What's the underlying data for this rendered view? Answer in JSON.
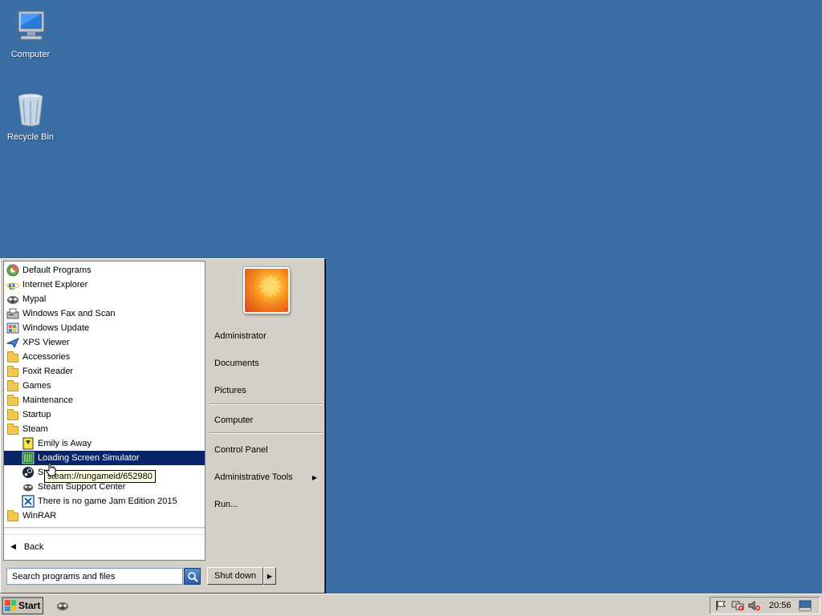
{
  "desktop": {
    "icons": [
      {
        "label": "Computer"
      },
      {
        "label": "Recycle Bin"
      }
    ],
    "background_color": "#3b6ea5"
  },
  "start_menu": {
    "programs": [
      {
        "label": "Default Programs",
        "icon": "default-programs-icon"
      },
      {
        "label": "Internet Explorer",
        "icon": "internet-explorer-icon"
      },
      {
        "label": "Mypal",
        "icon": "mypal-icon"
      },
      {
        "label": "Windows Fax and Scan",
        "icon": "fax-scan-icon"
      },
      {
        "label": "Windows Update",
        "icon": "windows-update-icon"
      },
      {
        "label": "XPS Viewer",
        "icon": "xps-viewer-icon"
      },
      {
        "label": "Accessories",
        "icon": "folder-icon"
      },
      {
        "label": "Foxit Reader",
        "icon": "folder-icon"
      },
      {
        "label": "Games",
        "icon": "folder-icon"
      },
      {
        "label": "Maintenance",
        "icon": "folder-icon"
      },
      {
        "label": "Startup",
        "icon": "folder-icon"
      },
      {
        "label": "Steam",
        "icon": "folder-icon"
      },
      {
        "label": "Emily is Away",
        "icon": "emily-is-away-icon"
      },
      {
        "label": "Loading Screen Simulator",
        "icon": "loading-screen-simulator-icon"
      },
      {
        "label": "Steam",
        "icon": "steam-icon"
      },
      {
        "label": "Steam Support Center",
        "icon": "steam-support-icon"
      },
      {
        "label": "There is no game Jam Edition 2015",
        "icon": "no-game-icon"
      },
      {
        "label": "WinRAR",
        "icon": "folder-icon"
      }
    ],
    "tooltip": "steam://rungameid/652980",
    "back_label": "Back",
    "search_placeholder": "Search programs and files",
    "right_items": {
      "user": "Administrator",
      "documents": "Documents",
      "pictures": "Pictures",
      "computer": "Computer",
      "control_panel": "Control Panel",
      "admin_tools": "Administrative Tools",
      "run": "Run..."
    },
    "shutdown_label": "Shut down",
    "highlight_color": "#0a246a"
  },
  "taskbar": {
    "start_label": "Start",
    "clock": "20:56"
  }
}
